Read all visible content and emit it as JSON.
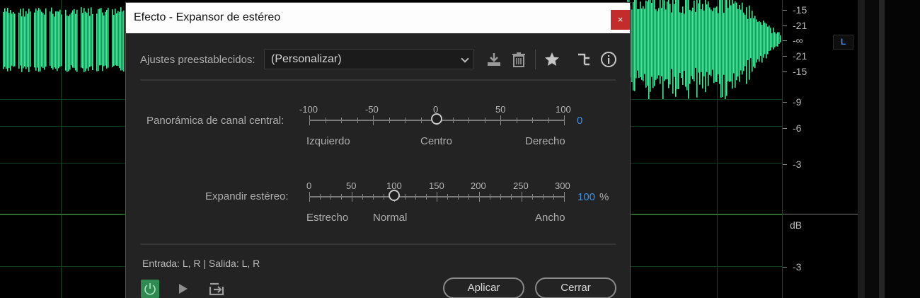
{
  "dialog": {
    "title": "Efecto - Expansor de estéreo",
    "close_glyph": "×",
    "presets_label": "Ajustes preestablecidos:",
    "presets_value": "(Personalizar)",
    "center_pan": {
      "label": "Panorámica de canal central:",
      "scale": [
        "-100",
        "-50",
        "0",
        "50",
        "100"
      ],
      "min": -100,
      "max": 100,
      "value": 0,
      "value_text": "0",
      "positions": [
        "Izquierdo",
        "Centro",
        "Derecho"
      ]
    },
    "stereo_expand": {
      "label": "Expandir estéreo:",
      "scale": [
        "0",
        "50",
        "100",
        "150",
        "200",
        "250",
        "300"
      ],
      "min": 0,
      "max": 300,
      "value": 100,
      "value_text": "100",
      "unit": "%",
      "positions": [
        "Estrecho",
        "Normal",
        "Ancho"
      ]
    },
    "io_text": "Entrada: L, R | Salida: L, R",
    "apply_label": "Aplicar",
    "cancel_label": "Cerrar"
  },
  "db_scale": [
    "-15",
    "-21",
    "-∞",
    "-21",
    "-15",
    "-9",
    "-6",
    "-3",
    "dB",
    "-3"
  ],
  "channel_badge": "L",
  "colors": {
    "waveform": "#4ee39c",
    "accent_blue": "#3f8fe4",
    "power_green": "#2f8b52",
    "close_red": "#c42b2b"
  },
  "icons": [
    "save-preset-icon",
    "delete-preset-icon",
    "favorite-star-icon",
    "routing-icon",
    "info-icon",
    "power-icon",
    "play-icon",
    "loop-icon"
  ]
}
